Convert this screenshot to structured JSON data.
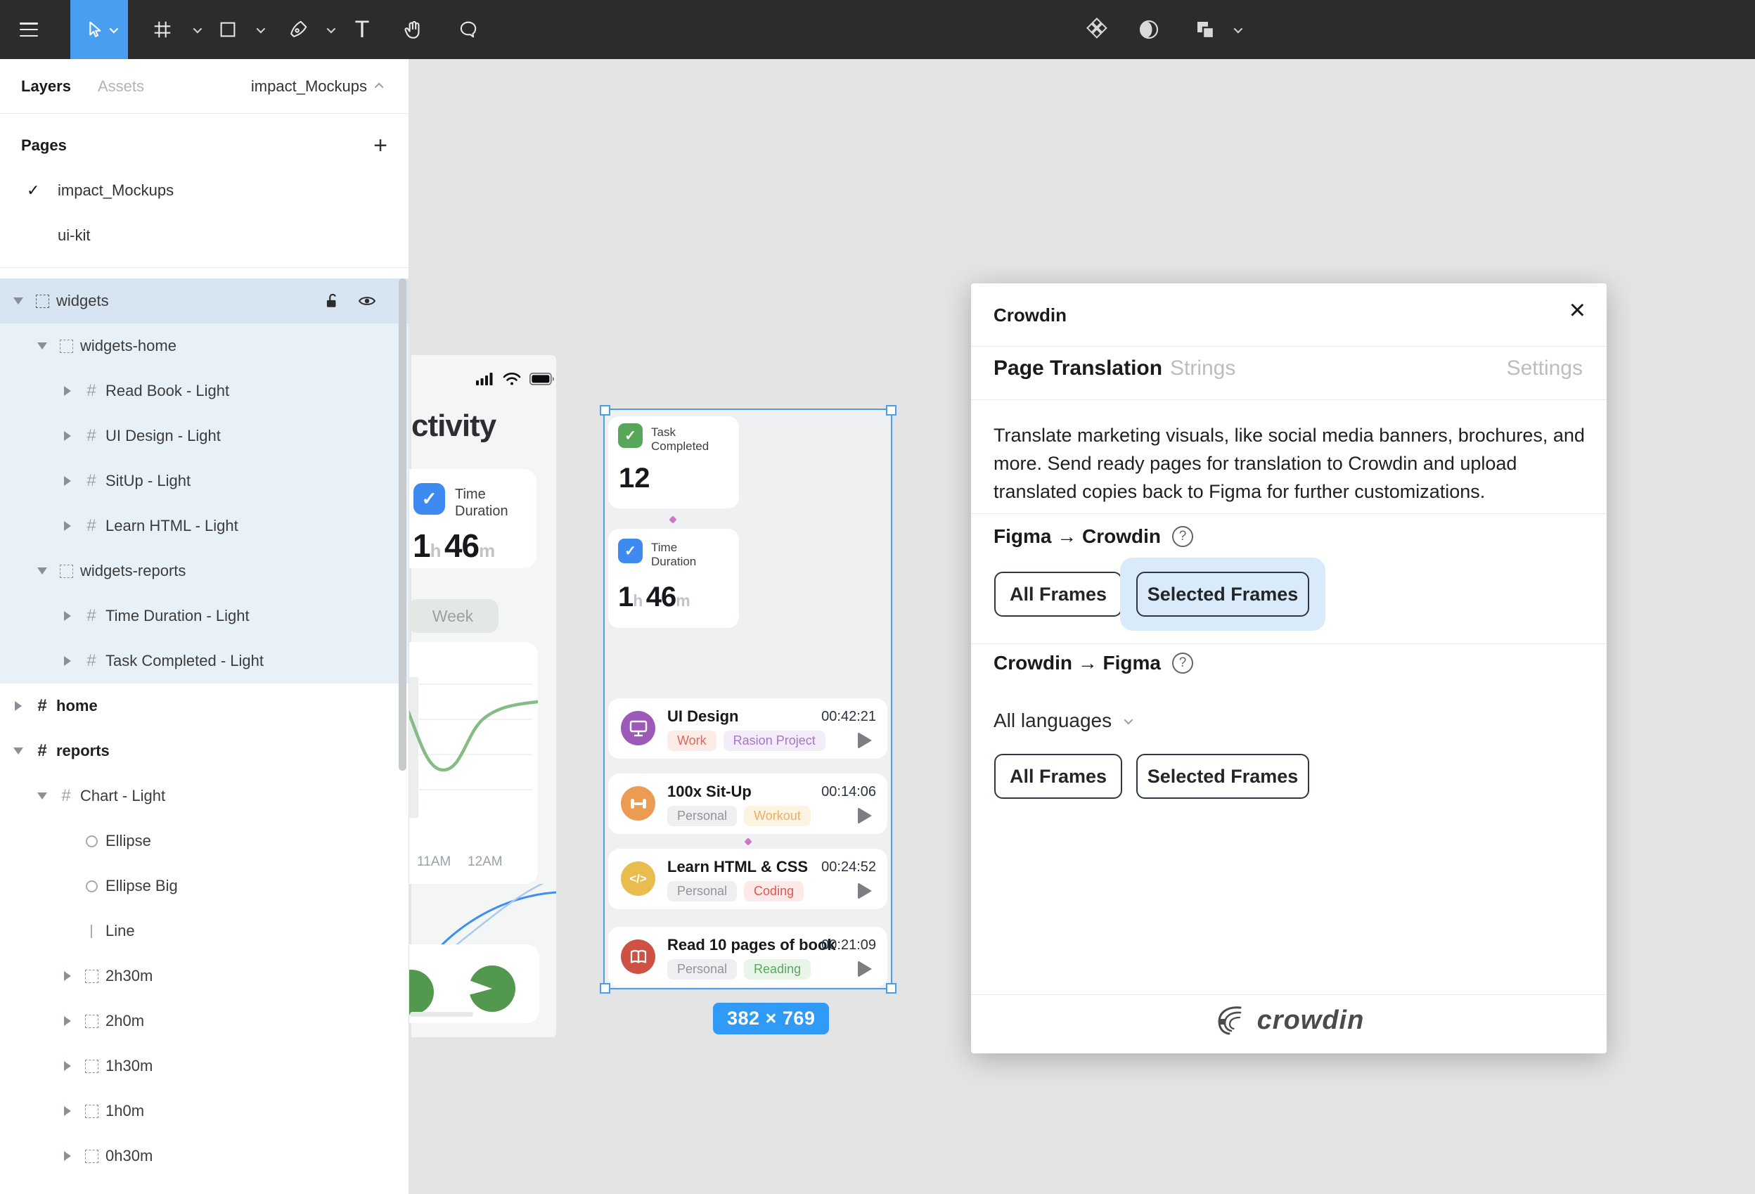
{
  "toolbar": {
    "left_icons": [
      "menu",
      "move-tool",
      "frame-tool",
      "shape-tool",
      "pen-tool",
      "text-tool",
      "hand-tool",
      "comment-tool"
    ],
    "right_icons": [
      "library",
      "mask",
      "boolean-ops"
    ],
    "active_tool": "move-tool",
    "accent_color": "#4a9ef2"
  },
  "sidebar": {
    "tabs": {
      "layers": "Layers",
      "assets": "Assets"
    },
    "file_name": "impact_Mockups",
    "pages": {
      "header": "Pages",
      "items": [
        {
          "label": "impact_Mockups",
          "checked": "✓"
        },
        {
          "label": "ui-kit",
          "checked": ""
        }
      ]
    },
    "tree": [
      {
        "label": "widgets"
      },
      {
        "label": "widgets-home"
      },
      {
        "label": "Read Book - Light"
      },
      {
        "label": "UI Design - Light"
      },
      {
        "label": "SitUp - Light"
      },
      {
        "label": "Learn HTML - Light"
      },
      {
        "label": "widgets-reports"
      },
      {
        "label": "Time Duration - Light"
      },
      {
        "label": "Task Completed - Light"
      },
      {
        "label": "home"
      },
      {
        "label": "reports"
      },
      {
        "label": "Chart - Light"
      },
      {
        "label": "Ellipse"
      },
      {
        "label": "Ellipse Big"
      },
      {
        "label": "Line"
      },
      {
        "label": "2h30m"
      },
      {
        "label": "2h0m"
      },
      {
        "label": "1h30m"
      },
      {
        "label": "1h0m"
      },
      {
        "label": "0h30m"
      }
    ]
  },
  "canvas": {
    "mockup": {
      "activity_partial": "ctivity",
      "time_duration": {
        "title": "Time Duration",
        "hours": "1",
        "hours_unit": "h",
        "minutes": "46",
        "minutes_unit": "m"
      },
      "week_pill": "Week",
      "x_labels": [
        "11AM",
        "12AM"
      ]
    },
    "frame": {
      "task_completed": {
        "title": "Task Completed",
        "value": "12"
      },
      "time_duration": {
        "title": "Time Duration",
        "hours": "1",
        "hours_unit": "h",
        "minutes": "46",
        "minutes_unit": "m"
      },
      "tasks": [
        {
          "title": "UI Design",
          "time": "00:42:21",
          "tags": [
            {
              "label": "Work"
            },
            {
              "label": "Rasion Project"
            }
          ],
          "icon": "monitor-icon",
          "icon_color": "#9c59b8"
        },
        {
          "title": "100x Sit-Up",
          "time": "00:14:06",
          "tags": [
            {
              "label": "Personal"
            },
            {
              "label": "Workout"
            }
          ],
          "icon": "dumbbell-icon",
          "icon_color": "#eb9b52"
        },
        {
          "title": "Learn HTML & CSS",
          "time": "00:24:52",
          "tags": [
            {
              "label": "Personal"
            },
            {
              "label": "Coding"
            }
          ],
          "icon": "code-icon",
          "icon_color": "#e9bd4d"
        },
        {
          "title": "Read 10 pages of book",
          "time": "00:21:09",
          "tags": [
            {
              "label": "Personal"
            },
            {
              "label": "Reading"
            }
          ],
          "icon": "book-icon",
          "icon_color": "#cd5244"
        }
      ]
    },
    "size_badge": "382 × 769",
    "selection_color": "#4a9ef2"
  },
  "plugin": {
    "title": "Crowdin",
    "tabs": {
      "page_translation": "Page Translation",
      "strings": "Strings",
      "settings": "Settings"
    },
    "description": "Translate marketing visuals, like social media banners, brochures, and more. Send ready pages for translation to Crowdin and upload translated copies back to Figma for further customizations.",
    "figma_to_crowdin": {
      "heading": "Figma → Crowdin",
      "all_frames": "All Frames",
      "selected_frames": "Selected Frames",
      "selected_highlight": "#d9eafb"
    },
    "crowdin_to_figma": {
      "heading": "Crowdin → Figma",
      "language_select": "All languages",
      "all_frames": "All Frames",
      "selected_frames": "Selected Frames"
    },
    "footer_logo": "crowdin"
  }
}
